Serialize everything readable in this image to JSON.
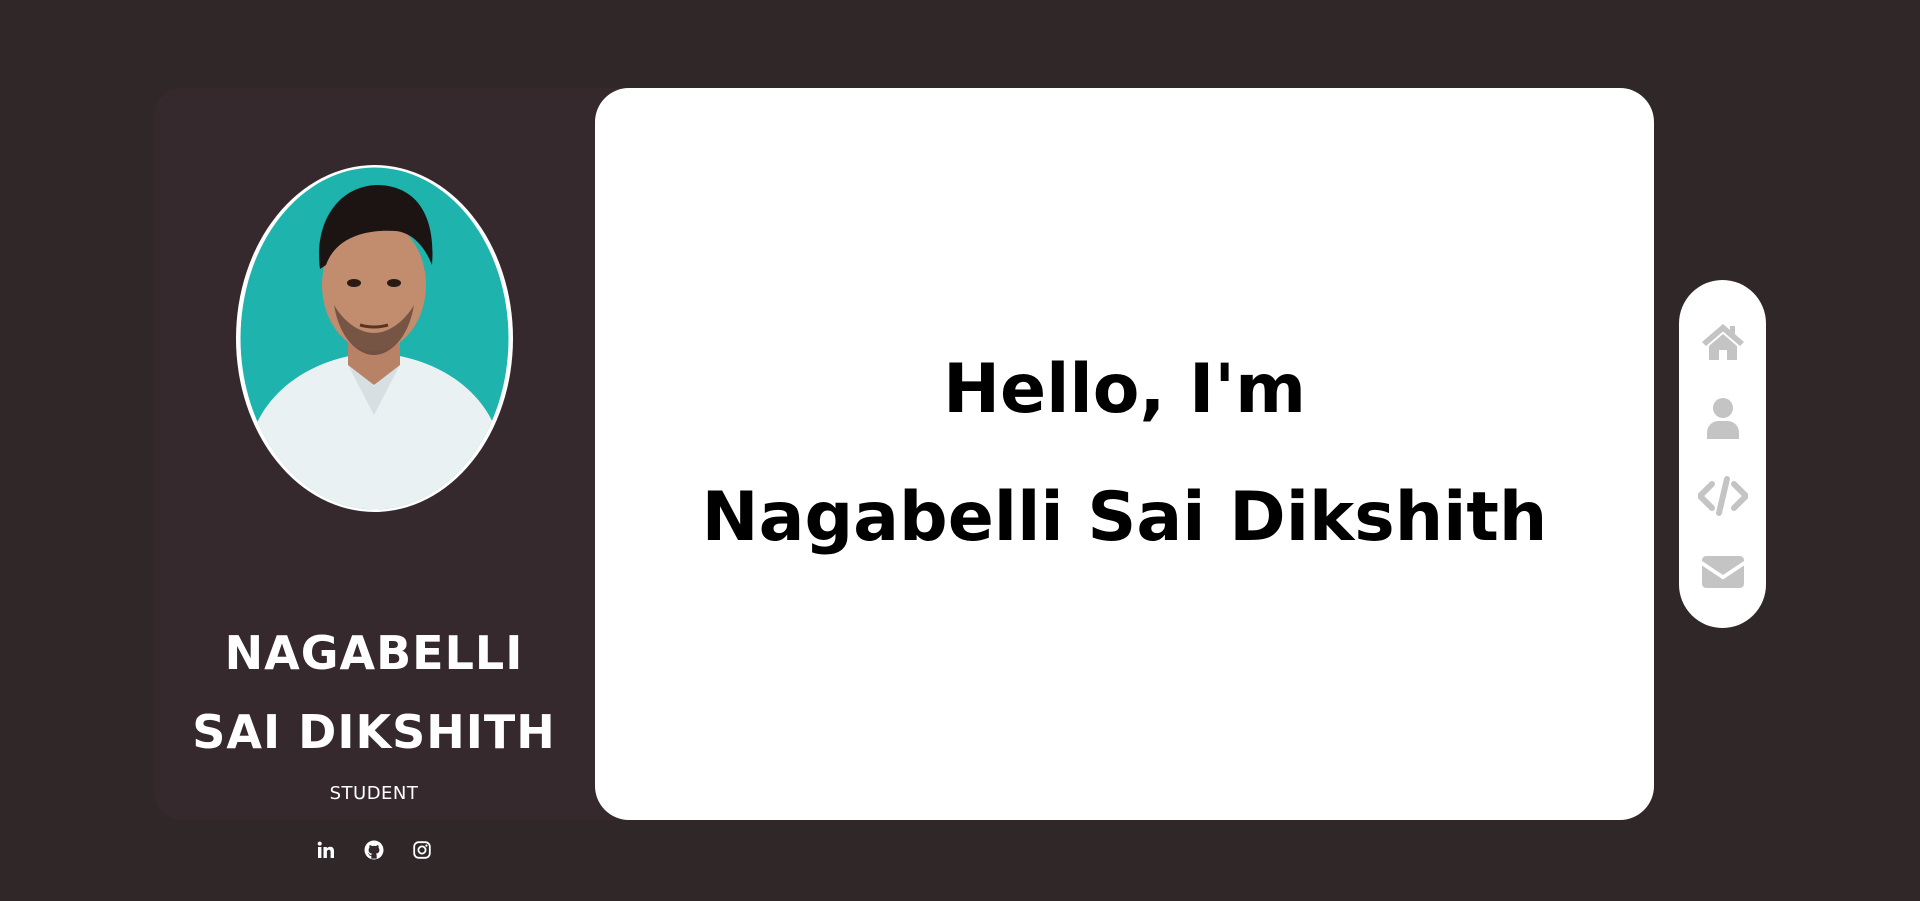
{
  "profile": {
    "name_line1": "NAGABELLI",
    "name_line2": "SAI DIKSHITH",
    "role": "STUDENT",
    "socials": [
      {
        "icon": "linkedin-icon"
      },
      {
        "icon": "github-icon"
      },
      {
        "icon": "instagram-icon"
      }
    ]
  },
  "hero": {
    "greeting": "Hello, I'm",
    "full_name": "Nagabelli Sai Dikshith"
  },
  "nav": {
    "items": [
      {
        "icon": "home-icon"
      },
      {
        "icon": "user-icon"
      },
      {
        "icon": "code-icon"
      },
      {
        "icon": "envelope-icon"
      }
    ]
  },
  "colors": {
    "page_background": "#302729",
    "card_background": "#36292d",
    "panel_background": "#ffffff",
    "nav_icon": "#c4c4c4",
    "avatar_backdrop": "#1eb3ad"
  }
}
